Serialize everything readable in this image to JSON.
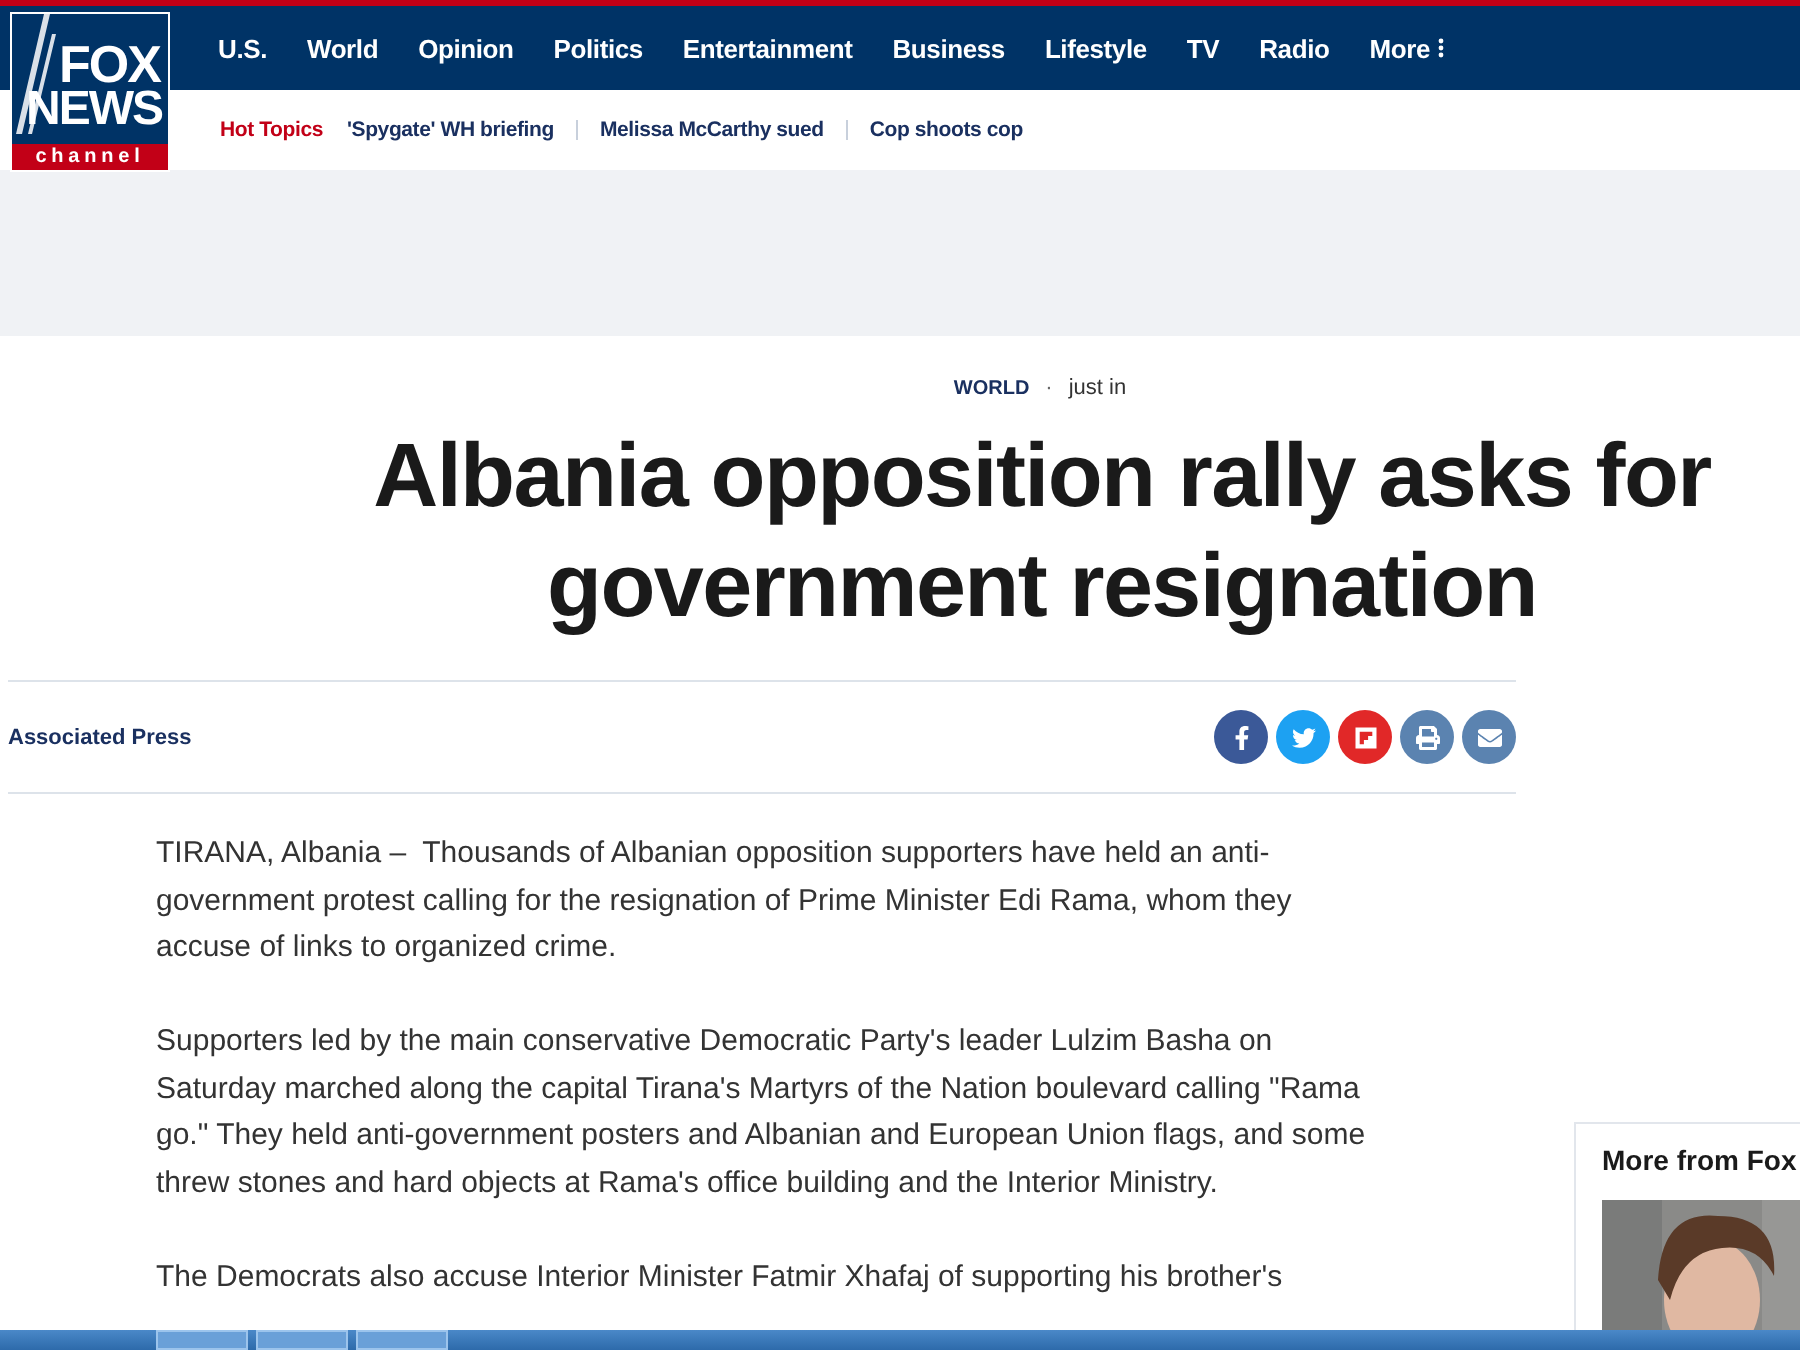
{
  "logo": {
    "top": "FOX",
    "middle": "NEWS",
    "bottom": "channel"
  },
  "nav": [
    {
      "label": "U.S."
    },
    {
      "label": "World"
    },
    {
      "label": "Opinion"
    },
    {
      "label": "Politics"
    },
    {
      "label": "Entertainment"
    },
    {
      "label": "Business"
    },
    {
      "label": "Lifestyle"
    },
    {
      "label": "TV"
    },
    {
      "label": "Radio"
    },
    {
      "label": "More",
      "kind": "menu"
    }
  ],
  "hot_topics": {
    "label": "Hot Topics",
    "items": [
      "'Spygate' WH briefing",
      "Melissa McCarthy sued",
      "Cop shoots cop"
    ]
  },
  "article": {
    "category": "WORLD",
    "separator": "·",
    "time": "just in",
    "headline": "Albania opposition rally asks for government resignation",
    "byline": "Associated Press",
    "share": [
      {
        "kind": "facebook"
      },
      {
        "kind": "twitter"
      },
      {
        "kind": "flipboard"
      },
      {
        "kind": "print"
      },
      {
        "kind": "email"
      }
    ],
    "paragraphs": [
      "TIRANA, Albania –  Thousands of Albanian opposition supporters have held an anti-government protest calling for the resignation of Prime Minister Edi Rama, whom they accuse of links to organized crime.",
      "Supporters led by the main conservative Democratic Party's leader Lulzim Basha on Saturday marched along the capital Tirana's Martyrs of the Nation boulevard calling \"Rama go.\" They held anti-government posters and Albanian and European Union flags, and some threw stones and hard objects at Rama's office building and the Interior Ministry.",
      "The Democrats also accuse Interior Minister Fatmir Xhafaj of supporting his brother's"
    ]
  },
  "sidebar": {
    "title": "More from Fox"
  }
}
